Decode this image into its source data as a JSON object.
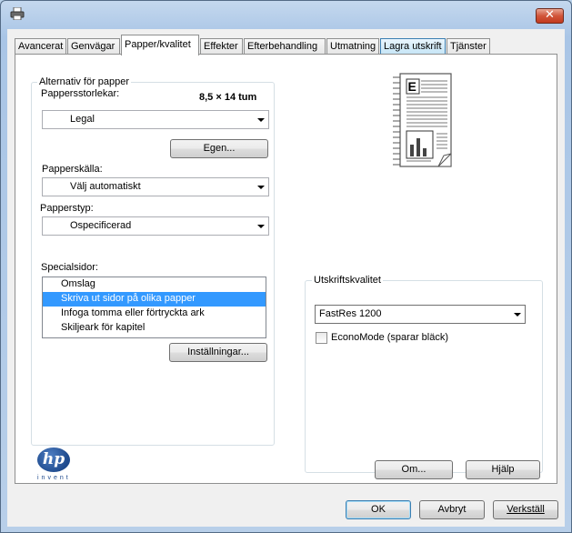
{
  "tabs": [
    {
      "label": "Avancerat"
    },
    {
      "label": "Genvägar"
    },
    {
      "label": "Papper/kvalitet"
    },
    {
      "label": "Effekter"
    },
    {
      "label": "Efterbehandling"
    },
    {
      "label": "Utmatning"
    },
    {
      "label": "Lagra utskrift"
    },
    {
      "label": "Tjänster"
    }
  ],
  "active_tab": "Papper/kvalitet",
  "paper_options": {
    "legend": "Alternativ för papper",
    "size_label": "Pappersstorlekar:",
    "size_display": "8,5 × 14 tum",
    "size_value": "Legal",
    "custom_button": "Egen...",
    "source_label": "Papperskälla:",
    "source_value": "Välj automatiskt",
    "type_label": "Papperstyp:",
    "type_value": "Ospecificerad"
  },
  "special_pages": {
    "label": "Specialsidor:",
    "items": [
      {
        "label": "Omslag",
        "selected": false
      },
      {
        "label": "Skriva ut sidor på olika papper",
        "selected": true
      },
      {
        "label": "Infoga tomma eller förtryckta ark",
        "selected": false
      },
      {
        "label": "Skiljeark för kapitel",
        "selected": false
      }
    ],
    "settings_button": "Inställningar..."
  },
  "print_quality": {
    "legend": "Utskriftskvalitet",
    "value": "FastRes 1200",
    "economode_label": "EconoMode (sparar bläck)",
    "economode_checked": false
  },
  "preview_letter": "E",
  "hp": {
    "logo_text": "hp",
    "tagline": "invent"
  },
  "about_button": "Om...",
  "help_button": "Hjälp",
  "ok_button": "OK",
  "cancel_button": "Avbryt",
  "apply_button": "Verkställ",
  "colors": {
    "selection": "#3399ff",
    "close_button": "#c23a1f",
    "hp_blue": "#1e4a8d"
  }
}
